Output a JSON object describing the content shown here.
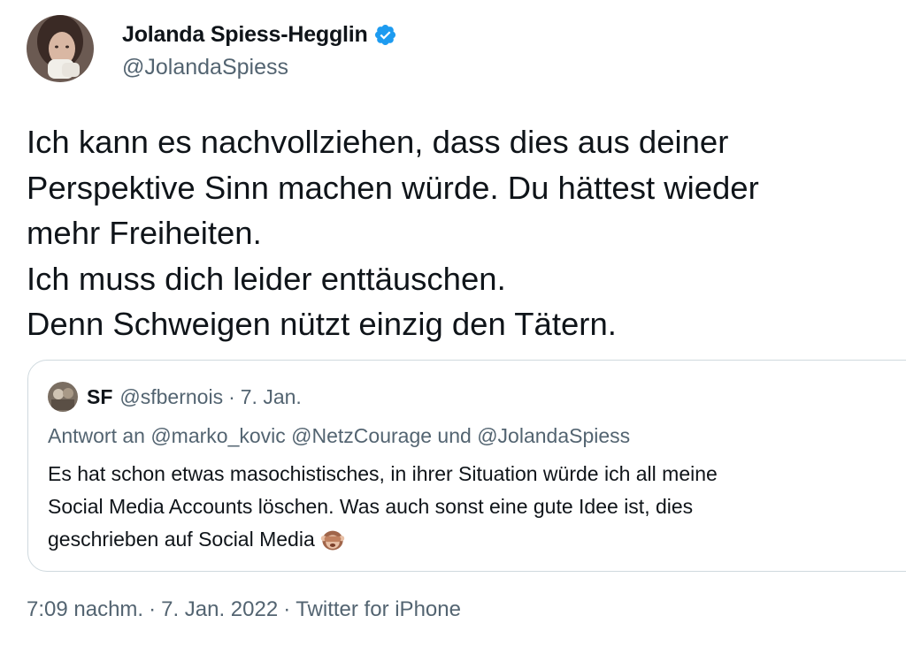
{
  "author": {
    "display_name": "Jolanda Spiess-Hegglin",
    "handle": "@JolandaSpiess",
    "verified": true,
    "avatar_icon": "profile-photo-avatar",
    "verified_icon": "verified-badge-icon"
  },
  "tweet": {
    "lines": [
      "Ich kann es nachvollziehen, dass dies aus deiner",
      "Perspektive Sinn machen würde. Du hättest wieder",
      "mehr Freiheiten.",
      "Ich muss dich leider enttäuschen.",
      "Denn Schweigen nützt einzig den Tätern."
    ]
  },
  "quoted_tweet": {
    "display_name": "SF",
    "handle": "@sfbernois",
    "separator": "·",
    "date": "7. Jan.",
    "reply_to": "Antwort an @marko_kovic @NetzCourage und @JolandaSpiess",
    "lines": [
      "Es hat schon etwas masochistisches, in ihrer Situation würde ich all meine",
      "Social Media Accounts löschen. Was auch sonst eine gute Idee ist, dies",
      "geschrieben auf Social Media"
    ],
    "emoji_icon": "see-no-evil-monkey-icon"
  },
  "footer": {
    "time": "7:09 nachm.",
    "separator": "·",
    "date": "7. Jan. 2022",
    "source": "Twitter for iPhone"
  },
  "colors": {
    "text_primary": "#0f1419",
    "text_secondary": "#536471",
    "verified_blue": "#1d9bf0",
    "border": "#cfd9de"
  }
}
